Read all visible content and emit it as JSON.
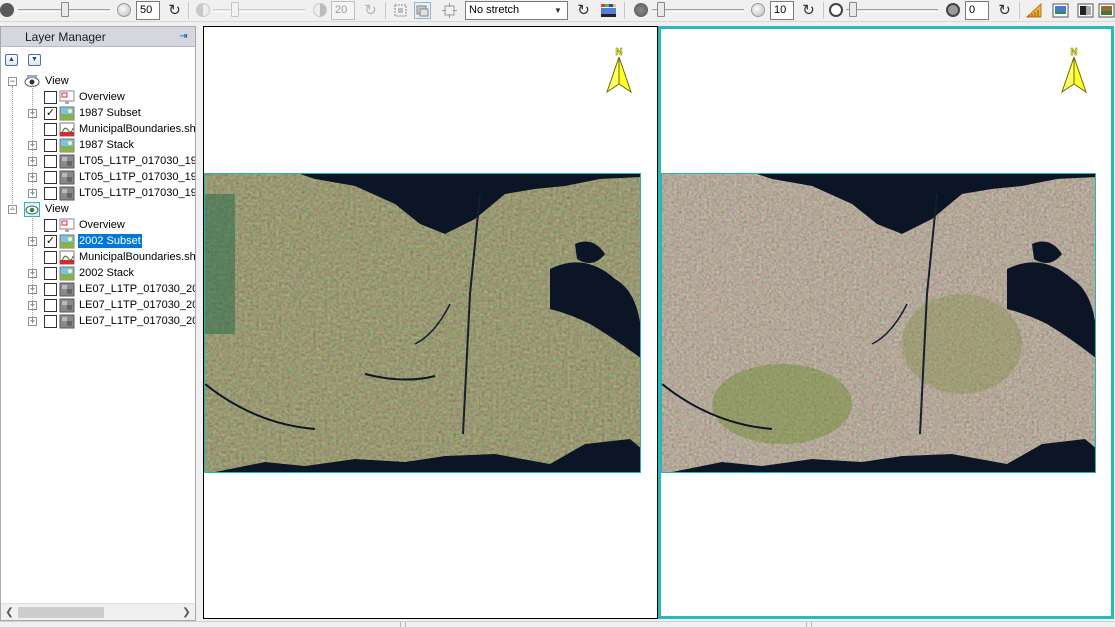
{
  "toolbar": {
    "brightness_value": "50",
    "contrast_value": "20",
    "stretch_selected": "No stretch",
    "transparency_value": "10",
    "swipe_value": "0"
  },
  "layer_manager": {
    "title": "Layer Manager",
    "views": [
      {
        "label": "View",
        "layers": [
          {
            "label": "Overview",
            "checked": false,
            "icon": "overview-icon"
          },
          {
            "label": "1987 Subset",
            "checked": true,
            "icon": "raster-icon"
          },
          {
            "label": "MunicipalBoundaries.shp",
            "checked": false,
            "icon": "shapefile-icon"
          },
          {
            "label": "1987 Stack",
            "checked": false,
            "icon": "raster-icon"
          },
          {
            "label": "LT05_L1TP_017030_19",
            "checked": false,
            "icon": "band-icon"
          },
          {
            "label": "LT05_L1TP_017030_19",
            "checked": false,
            "icon": "band-icon"
          },
          {
            "label": "LT05_L1TP_017030_19",
            "checked": false,
            "icon": "band-icon"
          }
        ]
      },
      {
        "label": "View",
        "layers": [
          {
            "label": "Overview",
            "checked": false,
            "icon": "overview-icon"
          },
          {
            "label": "2002 Subset",
            "checked": true,
            "icon": "raster-icon",
            "selected": true
          },
          {
            "label": "MunicipalBoundaries.shp",
            "checked": false,
            "icon": "shapefile-icon"
          },
          {
            "label": "2002 Stack",
            "checked": false,
            "icon": "raster-icon"
          },
          {
            "label": "LE07_L1TP_017030_20",
            "checked": false,
            "icon": "band-icon"
          },
          {
            "label": "LE07_L1TP_017030_20",
            "checked": false,
            "icon": "band-icon"
          },
          {
            "label": "LE07_L1TP_017030_20",
            "checked": false,
            "icon": "band-icon"
          }
        ]
      }
    ]
  },
  "map_views": {
    "north_arrow_label": "N"
  },
  "colors": {
    "active_view_border": "#2bb8b8",
    "selection": "#0078d7",
    "water": "#0b1525",
    "land_1987": "#5a5a1e",
    "land_2002": "#6e6a3c"
  }
}
